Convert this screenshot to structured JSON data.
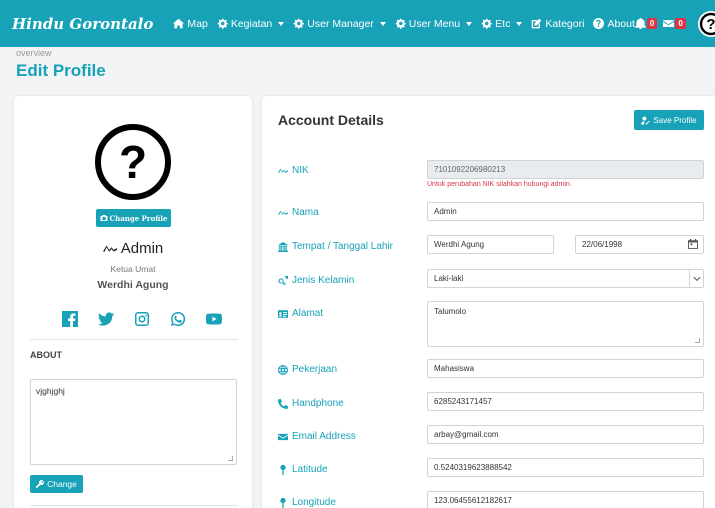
{
  "nav": {
    "brand": "Hindu Gorontalo",
    "items": [
      {
        "label": "Map",
        "icon": "home-icon",
        "dropdown": false
      },
      {
        "label": "Kegiatan",
        "icon": "gear-icon",
        "dropdown": true
      },
      {
        "label": "User Manager",
        "icon": "gear-icon",
        "dropdown": true
      },
      {
        "label": "User Menu",
        "icon": "gear-icon",
        "dropdown": true
      },
      {
        "label": "Etc",
        "icon": "gear-icon",
        "dropdown": true
      },
      {
        "label": "Kategori",
        "icon": "edit-icon",
        "dropdown": false
      },
      {
        "label": "About",
        "icon": "question-circle-icon",
        "dropdown": false
      }
    ],
    "notif_count": "0",
    "mail_count": "0"
  },
  "header": {
    "breadcrumb": "overview",
    "title": "Edit Profile"
  },
  "profile": {
    "change_profile_label": "Change Profile",
    "name": "Admin",
    "role": "Ketua Umat",
    "name2": "Werdhi Agung",
    "about_label": "ABOUT",
    "about_text": "vjghjghj",
    "change_label": "Change"
  },
  "account": {
    "title": "Account Details",
    "save_label": "Save Profile",
    "nik_label": "NIK",
    "nik_value": "7101092206980213",
    "nik_help": "Untuk perubahan NIK silahkan hubungi admin.",
    "nama_label": "Nama",
    "nama_value": "Admin",
    "ttl_label": "Tempat / Tanggal Lahir",
    "tempat_value": "Werdhi Agung",
    "tanggal_value": "22/06/1998",
    "jk_label": "Jenis Kelamin",
    "jk_value": "Laki-laki",
    "alamat_label": "Alamat",
    "alamat_value": "Talumolo",
    "pekerjaan_label": "Pekerjaan",
    "pekerjaan_value": "Mahasiswa",
    "hp_label": "Handphone",
    "hp_value": "6285243171457",
    "email_label": "Email Address",
    "email_value": "arbay@gmail.com",
    "lat_label": "Latitude",
    "lat_value": "0.5240319623888542",
    "lng_label": "Longitude",
    "lng_value": "123.06455612182617"
  },
  "colors": {
    "accent": "#17a2b8",
    "danger": "#dc3545"
  }
}
